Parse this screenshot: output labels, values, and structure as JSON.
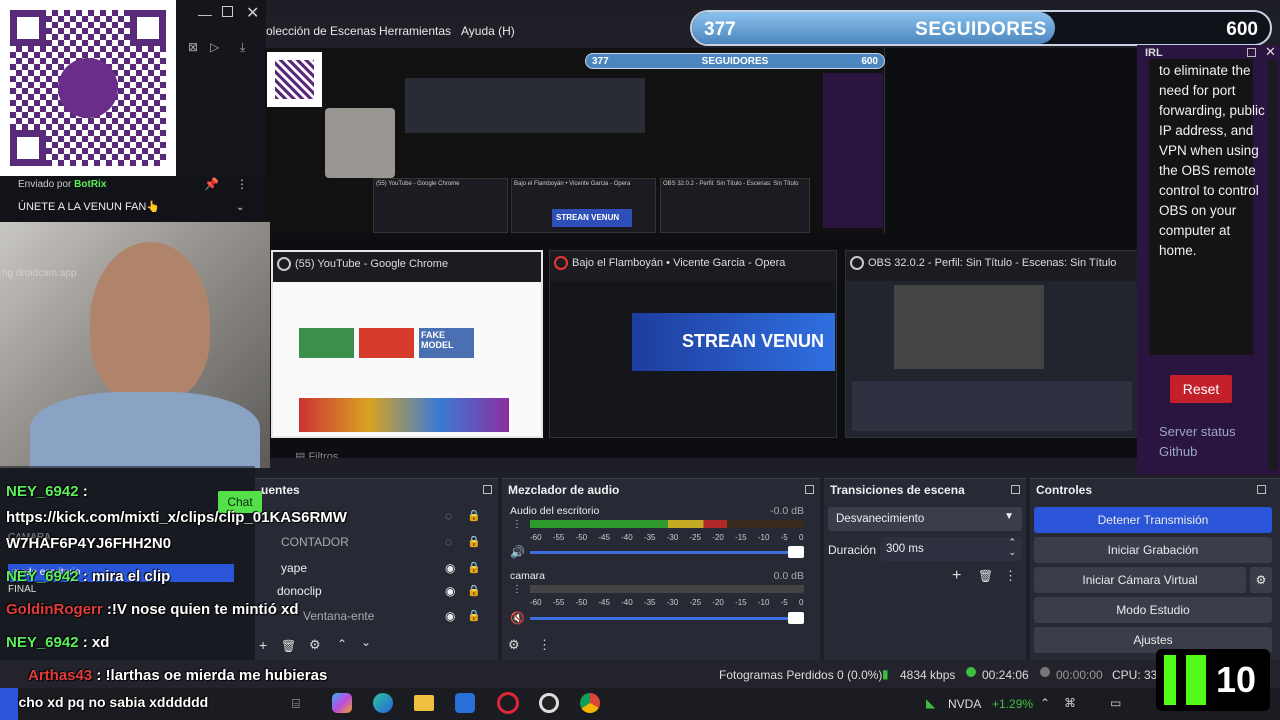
{
  "menubar": {
    "items": [
      "olección de Escenas",
      "Herramientas",
      "Ayuda (H)"
    ]
  },
  "followers": {
    "current": "377",
    "label": "SEGUIDORES",
    "goal": "600",
    "progress": 0.628
  },
  "preview": {
    "mini_followers": {
      "current": "377",
      "label": "SEGUIDORES",
      "goal": "600"
    },
    "windows": [
      {
        "title": "(55) YouTube - Google Chrome",
        "thumb_text": "FAKE MODEL"
      },
      {
        "title": "Bajo el Flamboyán • Vicente Garcia - Opera",
        "thumb_text": "STREAN VENUN"
      },
      {
        "title": "OBS 32.0.2 - Perfil: Sin Título - Escenas: Sin Título"
      }
    ],
    "mini_titles": [
      "(55) YouTube - Google Chrome",
      "Bajo el Flamboyán • Vicente Garcia - Opera",
      "OBS 32.0.2 - Perfil: Sin Título - Escenas: Sin Título"
    ],
    "mini_stream": "STREAN VENUN"
  },
  "right_panel": {
    "header": "IRL",
    "text": "to eliminate the need for port forwarding, public IP address, and VPN when using the OBS remote control to control OBS on your computer at home.",
    "reset": "Reset",
    "server_status": "Server status",
    "github": "Github"
  },
  "pinned": {
    "sent_by": "Enviado por",
    "user": "BotRix",
    "message": "ÚNETE A LA VENUN FAN👆",
    "link": "https://chat.whatsapp.com/KHIVF..."
  },
  "webcam": {
    "watermark": "ng droidcam.app"
  },
  "sources": {
    "title": "uentes",
    "items": [
      "CONTADOR",
      "yape",
      "donoclip",
      "Ventana-ente"
    ]
  },
  "mixer": {
    "title": "Mezclador de audio",
    "channels": [
      {
        "name": "Audio del escritorio",
        "db": "-0.0 dB",
        "level": 0.72
      },
      {
        "name": "camara",
        "db": "0.0 dB",
        "level": 0.0
      }
    ],
    "scale": "-60 -55 -50 -45 -40 -35 -30 -25 -20 -15 -10 -5 0"
  },
  "transitions": {
    "title": "Transiciones de escena",
    "selected": "Desvanecimiento",
    "duration_label": "Duración",
    "duration_value": "300 ms"
  },
  "controls": {
    "title": "Controles",
    "buttons": [
      "Detener Transmisión",
      "Iniciar Grabación",
      "Iniciar Cámara Virtual",
      "Modo Estudio",
      "Ajustes"
    ]
  },
  "chat": {
    "chat_button": "Chat",
    "lines": [
      {
        "user": "NEY_6942",
        "sep": " :",
        "text": "",
        "color": "green"
      },
      {
        "user": "",
        "sep": "",
        "text": "https://kick.com/mixti_x/clips/clip_01KAS6RMW",
        "color": "green"
      },
      {
        "user": "",
        "sep": "",
        "text": "W7HAF6P4YJ6FHH2N0",
        "color": "green"
      },
      {
        "user": "NEY_6942",
        "sep": " :",
        "text": " mira el clip",
        "color": "green"
      },
      {
        "user": "GoldinRogerr",
        "sep": " :",
        "text": "!V nose quien te mintió xd",
        "color": "red"
      },
      {
        "user": "NEY_6942",
        "sep": " :",
        "text": " xd",
        "color": "green"
      },
      {
        "user": "Arthas43",
        "sep": " :",
        "text": " !larthas oe mierda me hubieras",
        "color": "red"
      },
      {
        "user": "",
        "sep": "",
        "text": "dicho xd pq no sabia xdddddd",
        "color": "green"
      }
    ],
    "under_labels": [
      "modo escritorio",
      "FINAL",
      "CAMARA"
    ]
  },
  "status": {
    "dropped": "Fotogramas Perdidos 0 (0.0%)",
    "kbps": "4834 kbps",
    "live": "00:24:06",
    "rec": "00:00:00",
    "cpu": "CPU: 33."
  },
  "taskbar": {
    "stock": "NVDA",
    "change": "+1.29%"
  },
  "kick": {
    "count": "10"
  },
  "colors": {
    "accent_blue": "#2a55d8",
    "reset_red": "#c4202b",
    "panel_purple": "#2a1440",
    "chat_green": "#5cf05c",
    "chat_red": "#e23c3c"
  }
}
